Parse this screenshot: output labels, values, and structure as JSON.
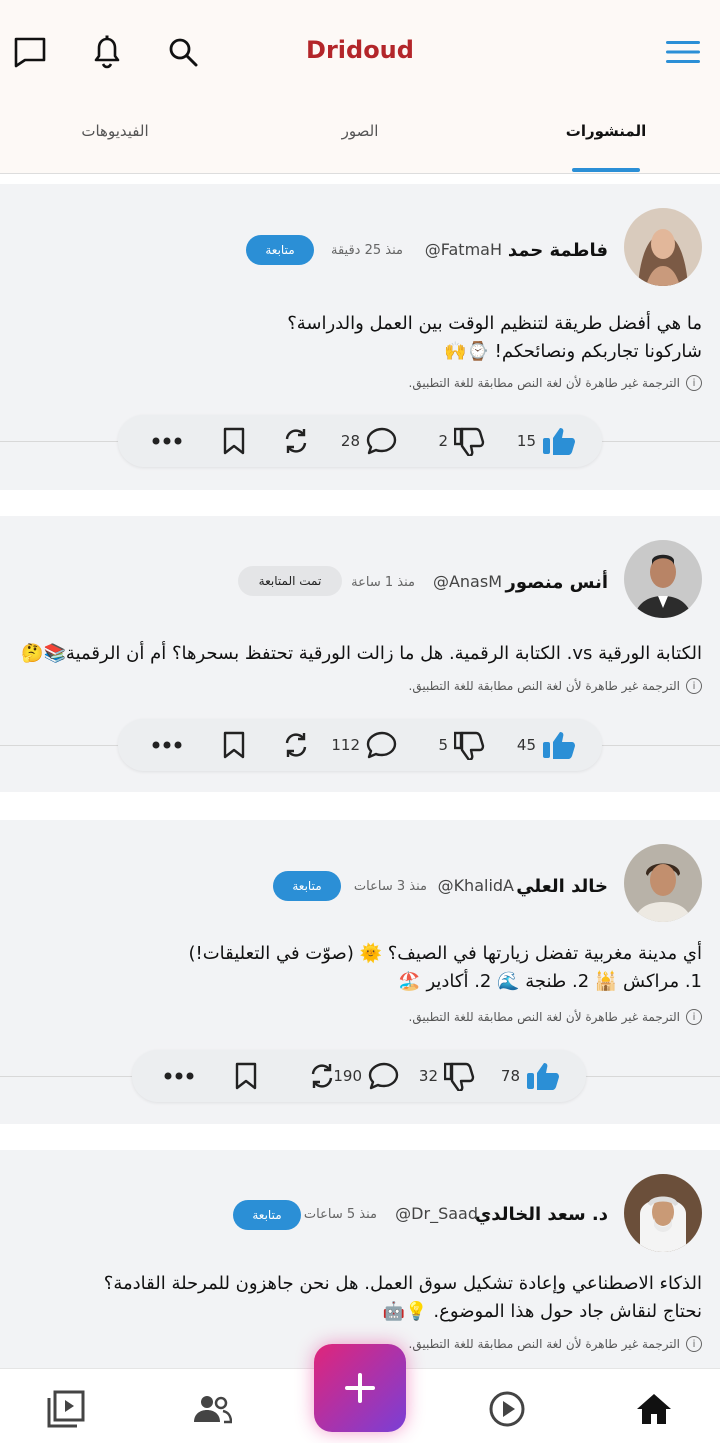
{
  "app": {
    "title": "Dridoud"
  },
  "tabs": [
    {
      "label": "المنشورات",
      "active": true
    },
    {
      "label": "الصور",
      "active": false
    },
    {
      "label": "الفيديوهات",
      "active": false
    }
  ],
  "translation_note": "الترجمة غير طاهرة لأن لغة النص مطابقة للغة التطبيق.",
  "posts": [
    {
      "name": "فاطمة حمد",
      "handle": "@FatmaH",
      "time": "منذ 25 دقيقة",
      "follow_label": "متابعة",
      "line1": "ما هي أفضل طريقة لتنظيم الوقت بين العمل والدراسة؟",
      "line2": "شاركونا تجاربكم ونصائحكم! ⌚🙌",
      "likes": "15",
      "dislikes": "2",
      "comments": "28"
    },
    {
      "name": "أنس منصور",
      "handle": "@AnasM",
      "time": "منذ 1 ساعة",
      "follow_label": "تمت المتابعة",
      "line1": "الكتابة الورقية vs. الكتابة الرقمية. هل ما زالت الورقية تحتفظ بسحرها؟ أم أن الرقمية📚🤔",
      "line2": "",
      "likes": "45",
      "dislikes": "5",
      "comments": "112"
    },
    {
      "name": "خالد العلي",
      "handle": "@KhalidA",
      "time": "منذ 3 ساعات",
      "follow_label": "متابعة",
      "line1": "أي مدينة مغربية تفضل زيارتها في الصيف؟ 🌞 (صوّت في التعليقات!)",
      "line2": "1. مراكش 🕌  2. طنجة 🌊  2. أكادير 🏖️",
      "likes": "78",
      "dislikes": "32",
      "comments": "190"
    },
    {
      "name": "د. سعد الخالدي",
      "handle": "@Dr_Saad",
      "time": "منذ 5 ساعات",
      "follow_label": "متابعة",
      "line1": "الذكاء الاصطناعي وإعادة تشكيل سوق العمل. هل نحن جاهزون للمرحلة القادمة؟",
      "line2": "نحتاج لنقاش جاد حول هذا الموضوع. 💡🤖"
    }
  ],
  "colors": {
    "brand": "#b3262a",
    "accent": "#2b8fd6",
    "fab_start": "#e0257a",
    "fab_end": "#7a3fd6"
  },
  "icons": {
    "header": [
      "chat-icon",
      "bell-icon",
      "search-icon",
      "menu-icon"
    ],
    "actions": [
      "thumbs-up-icon",
      "thumbs-down-icon",
      "comment-icon",
      "repost-icon",
      "bookmark-icon",
      "more-icon"
    ],
    "bottom_nav": [
      "video-library-icon",
      "people-icon",
      "add-icon",
      "play-icon",
      "home-icon"
    ]
  }
}
